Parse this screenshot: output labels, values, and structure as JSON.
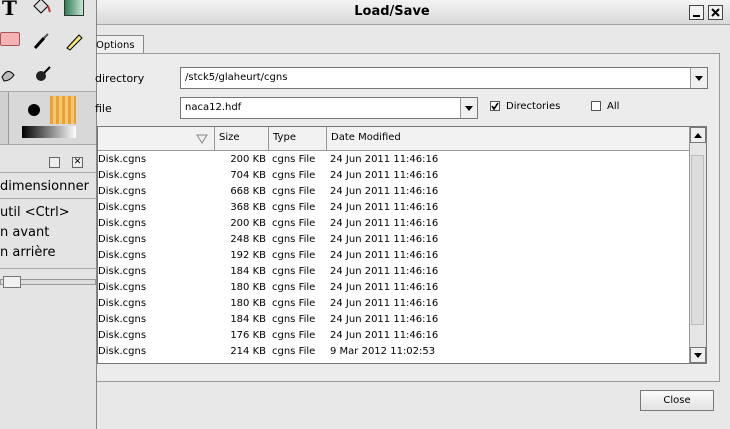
{
  "toolbox": {
    "labels": [
      "dimensionner",
      "util  <Ctrl>",
      "n avant",
      "n arrière"
    ]
  },
  "dialog": {
    "title": "Load/Save",
    "tab_label": "Options",
    "directory_label": "directory",
    "directory_value": "/stck5/glaheurt/cgns",
    "file_label": "file",
    "file_value": "naca12.hdf",
    "checkbox_directories_label": "Directories",
    "checkbox_directories_checked": true,
    "checkbox_all_label": "All",
    "checkbox_all_checked": false,
    "columns": [
      "",
      "Size",
      "Type",
      "Date Modified"
    ],
    "files": [
      {
        "name": "Disk.cgns",
        "size": "200 KB",
        "type": "cgns File",
        "date": "24 Jun 2011 11:46:16"
      },
      {
        "name": "Disk.cgns",
        "size": "704 KB",
        "type": "cgns File",
        "date": "24 Jun 2011 11:46:16"
      },
      {
        "name": "Disk.cgns",
        "size": "668 KB",
        "type": "cgns File",
        "date": "24 Jun 2011 11:46:16"
      },
      {
        "name": "Disk.cgns",
        "size": "368 KB",
        "type": "cgns File",
        "date": "24 Jun 2011 11:46:16"
      },
      {
        "name": "Disk.cgns",
        "size": "200 KB",
        "type": "cgns File",
        "date": "24 Jun 2011 11:46:16"
      },
      {
        "name": "Disk.cgns",
        "size": "248 KB",
        "type": "cgns File",
        "date": "24 Jun 2011 11:46:16"
      },
      {
        "name": "Disk.cgns",
        "size": "192 KB",
        "type": "cgns File",
        "date": "24 Jun 2011 11:46:16"
      },
      {
        "name": "Disk.cgns",
        "size": "184 KB",
        "type": "cgns File",
        "date": "24 Jun 2011 11:46:16"
      },
      {
        "name": "Disk.cgns",
        "size": "180 KB",
        "type": "cgns File",
        "date": "24 Jun 2011 11:46:16"
      },
      {
        "name": "Disk.cgns",
        "size": "180 KB",
        "type": "cgns File",
        "date": "24 Jun 2011 11:46:16"
      },
      {
        "name": "Disk.cgns",
        "size": "184 KB",
        "type": "cgns File",
        "date": "24 Jun 2011 11:46:16"
      },
      {
        "name": "Disk.cgns",
        "size": "176 KB",
        "type": "cgns File",
        "date": "24 Jun 2011 11:46:16"
      },
      {
        "name": "Disk.cgns",
        "size": "214 KB",
        "type": "cgns File",
        "date": "9 Mar 2012 11:02:53"
      }
    ],
    "close_label": "Close",
    "icons": {
      "minimize": "minimize-icon",
      "close": "close-icon",
      "dropdown": "chevron-down-icon",
      "sort": "sort-arrow-icon"
    }
  }
}
